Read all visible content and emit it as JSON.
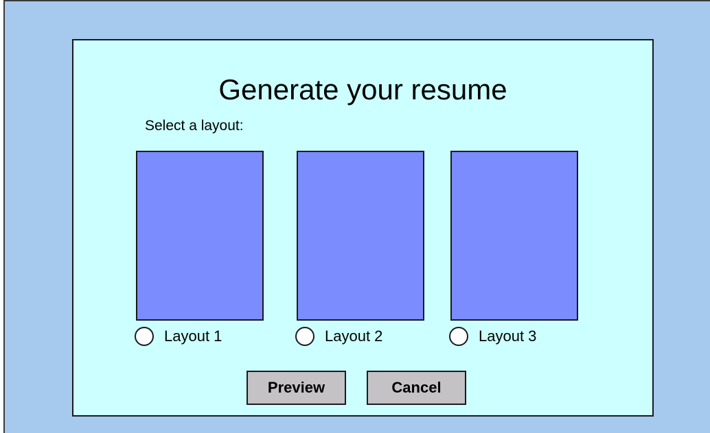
{
  "dialog": {
    "title": "Generate your resume",
    "select_label": "Select a layout:"
  },
  "layouts": [
    {
      "label": "Layout 1",
      "selected": false
    },
    {
      "label": "Layout 2",
      "selected": false
    },
    {
      "label": "Layout 3",
      "selected": false
    }
  ],
  "buttons": {
    "preview_label": "Preview",
    "cancel_label": "Cancel"
  },
  "colors": {
    "background": "#a6c9ee",
    "dialog": "#ccffff",
    "thumbnail": "#7b8cff",
    "button": "#c4c2c4"
  }
}
